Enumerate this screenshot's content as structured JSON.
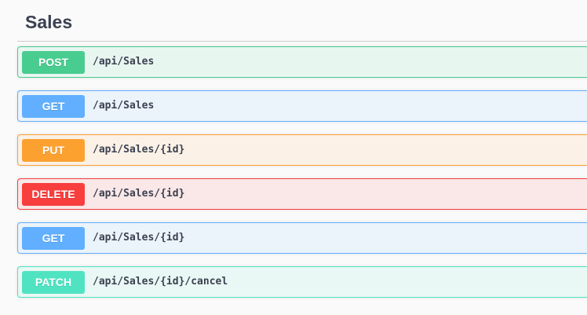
{
  "section": {
    "title": "Sales"
  },
  "operations": [
    {
      "method": "POST",
      "path": "/api/Sales",
      "color": "#49cc90"
    },
    {
      "method": "GET",
      "path": "/api/Sales",
      "color": "#61affe"
    },
    {
      "method": "PUT",
      "path": "/api/Sales/{id}",
      "color": "#fca130"
    },
    {
      "method": "DELETE",
      "path": "/api/Sales/{id}",
      "color": "#f93e3e"
    },
    {
      "method": "GET",
      "path": "/api/Sales/{id}",
      "color": "#61affe"
    },
    {
      "method": "PATCH",
      "path": "/api/Sales/{id}/cancel",
      "color": "#50e3c2"
    }
  ]
}
